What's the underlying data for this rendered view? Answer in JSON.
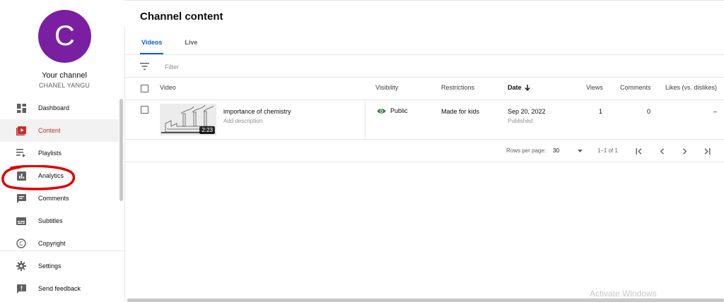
{
  "channel": {
    "avatar_letter": "C",
    "title": "Your channel",
    "name": "CHANEL YANGU",
    "avatar_color": "#7b1fa2"
  },
  "sidebar": {
    "items": [
      {
        "label": "Dashboard",
        "icon": "dashboard-icon"
      },
      {
        "label": "Content",
        "icon": "content-icon",
        "active": true
      },
      {
        "label": "Playlists",
        "icon": "playlists-icon"
      },
      {
        "label": "Analytics",
        "icon": "analytics-icon"
      },
      {
        "label": "Comments",
        "icon": "comments-icon"
      },
      {
        "label": "Subtitles",
        "icon": "subtitles-icon"
      },
      {
        "label": "Copyright",
        "icon": "copyright-icon"
      },
      {
        "label": "Settings",
        "icon": "gear-icon"
      },
      {
        "label": "Send feedback",
        "icon": "feedback-icon"
      }
    ]
  },
  "main": {
    "title": "Channel content",
    "tabs": [
      {
        "label": "Videos",
        "active": true
      },
      {
        "label": "Live"
      }
    ],
    "filter_placeholder": "Filter",
    "columns": {
      "video": "Video",
      "visibility": "Visibility",
      "restrictions": "Restrictions",
      "date": "Date",
      "views": "Views",
      "comments": "Comments",
      "likes": "Likes (vs. dislikes)"
    },
    "rows": [
      {
        "title": "importance of chemistry",
        "description": "Add description",
        "duration": "2:23",
        "visibility": "Public",
        "restrictions": "Made for kids",
        "date": "Sep 20, 2022",
        "date_status": "Published",
        "views": "1",
        "comments": "0",
        "likes": "–"
      }
    ],
    "pagination": {
      "rows_per_page_label": "Rows per page:",
      "rows_per_page": "30",
      "range": "1–1 of 1"
    }
  },
  "watermark": "Activate Windows",
  "colors": {
    "accent": "#065fd4",
    "active_nav": "#c4302b",
    "visibility_icon": "#2e7d32",
    "annotation": "#e00000"
  }
}
